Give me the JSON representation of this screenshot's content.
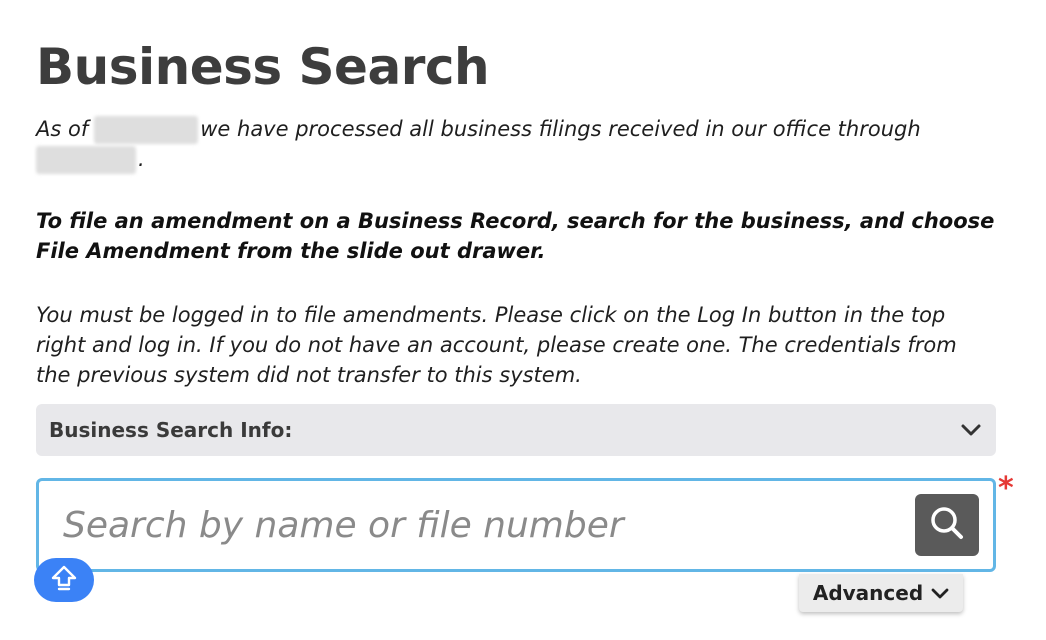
{
  "header": {
    "title": "Business Search"
  },
  "intro": {
    "prefix": "As of",
    "middle": "we have processed all business filings received in our office through",
    "suffix": "."
  },
  "notice": {
    "amendment": "To file an amendment on a Business Record, search for the business, and choose File Amendment from the slide out drawer.",
    "login": "You must be logged in to file amendments. Please click on the Log In button in the top right and log in. If you do not have an account, please create one. The credentials from the previous system did not transfer to this system."
  },
  "accordion": {
    "label": "Business Search Info:",
    "icon": "chevron-down-icon"
  },
  "search": {
    "placeholder": "Search by name or file number",
    "value": "",
    "required_marker": "*",
    "button_icon": "search-icon"
  },
  "advanced": {
    "label": "Advanced",
    "icon": "chevron-down-icon"
  },
  "fab": {
    "icon": "arrow-up-icon"
  },
  "colors": {
    "accent_border": "#62b6e6",
    "search_button": "#5a5a5a",
    "required": "#e53935",
    "fab": "#3b82f6",
    "accordion_bg": "#e8e8eb"
  }
}
